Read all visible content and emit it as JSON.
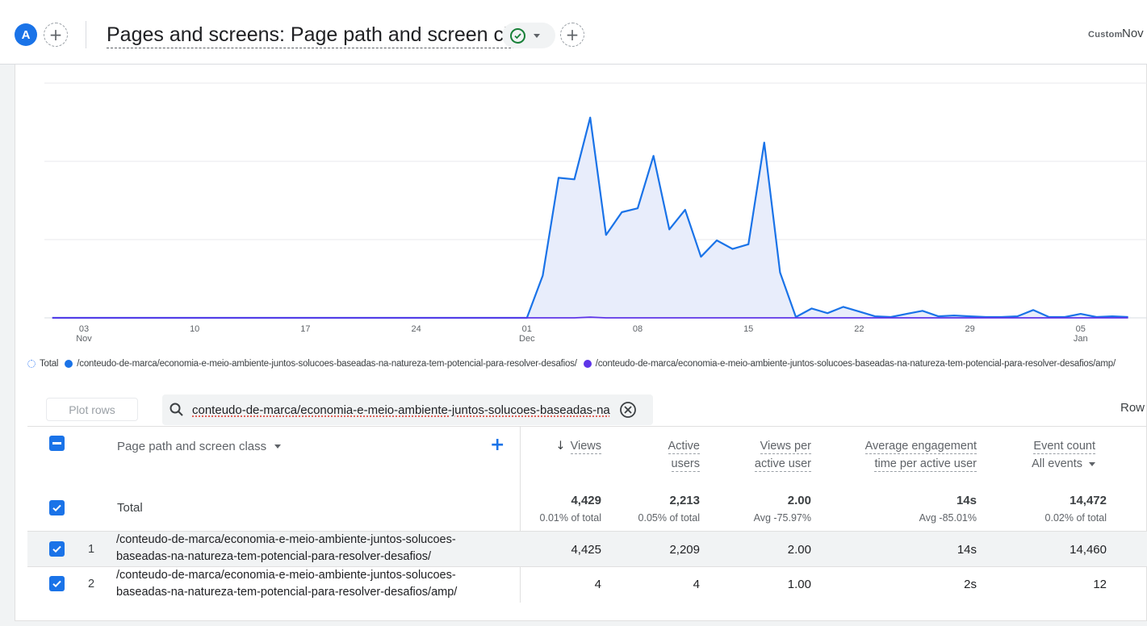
{
  "header": {
    "avatar_letter": "A",
    "title": "Pages and screens: Page path and screen class",
    "custom_label": "Custom",
    "date_label": "Nov"
  },
  "chart_data": {
    "type": "line",
    "x_ticks": [
      {
        "day": "03",
        "month": "Nov"
      },
      {
        "day": "10",
        "month": ""
      },
      {
        "day": "17",
        "month": ""
      },
      {
        "day": "24",
        "month": ""
      },
      {
        "day": "01",
        "month": "Dec"
      },
      {
        "day": "08",
        "month": ""
      },
      {
        "day": "15",
        "month": ""
      },
      {
        "day": "22",
        "month": ""
      },
      {
        "day": "29",
        "month": ""
      },
      {
        "day": "05",
        "month": "Jan"
      }
    ],
    "x_range": [
      "2024-11-01",
      "2025-01-08"
    ],
    "y_range": [
      0,
      1500
    ],
    "grid": true,
    "legend": [
      {
        "name": "Total",
        "color": "#4285f4",
        "style": "dotted"
      },
      {
        "name": "/conteudo-de-marca/economia-e-meio-ambiente-juntos-solucoes-baseadas-na-natureza-tem-potencial-para-resolver-desafios/",
        "color": "#1a73e8",
        "style": "solid"
      },
      {
        "name": "/conteudo-de-marca/economia-e-meio-ambiente-juntos-solucoes-baseadas-na-natureza-tem-potencial-para-resolver-desafios/amp/",
        "color": "#5e35e8",
        "style": "solid"
      }
    ],
    "series": [
      {
        "name": "/conteudo-de-marca/economia-e-meio-ambiente-juntos-solucoes-baseadas-na-natureza-tem-potencial-para-resolver-desafios/",
        "color": "#1a73e8",
        "fill": "#e8edfb",
        "points": [
          [
            "2024-11-01",
            0
          ],
          [
            "2024-11-30",
            0
          ],
          [
            "2024-12-01",
            0
          ],
          [
            "2024-12-02",
            270
          ],
          [
            "2024-12-03",
            895
          ],
          [
            "2024-12-04",
            885
          ],
          [
            "2024-12-05",
            1280
          ],
          [
            "2024-12-06",
            530
          ],
          [
            "2024-12-07",
            675
          ],
          [
            "2024-12-08",
            700
          ],
          [
            "2024-12-09",
            1035
          ],
          [
            "2024-12-10",
            565
          ],
          [
            "2024-12-11",
            690
          ],
          [
            "2024-12-12",
            390
          ],
          [
            "2024-12-13",
            495
          ],
          [
            "2024-12-14",
            440
          ],
          [
            "2024-12-15",
            470
          ],
          [
            "2024-12-16",
            1120
          ],
          [
            "2024-12-17",
            290
          ],
          [
            "2024-12-18",
            5
          ],
          [
            "2024-12-19",
            60
          ],
          [
            "2024-12-20",
            30
          ],
          [
            "2024-12-21",
            70
          ],
          [
            "2024-12-22",
            40
          ],
          [
            "2024-12-23",
            10
          ],
          [
            "2024-12-24",
            5
          ],
          [
            "2024-12-25",
            25
          ],
          [
            "2024-12-26",
            45
          ],
          [
            "2024-12-27",
            10
          ],
          [
            "2024-12-28",
            15
          ],
          [
            "2024-12-29",
            10
          ],
          [
            "2024-12-30",
            5
          ],
          [
            "2024-12-31",
            5
          ],
          [
            "2025-01-01",
            10
          ],
          [
            "2025-01-02",
            50
          ],
          [
            "2025-01-03",
            5
          ],
          [
            "2025-01-04",
            5
          ],
          [
            "2025-01-05",
            25
          ],
          [
            "2025-01-06",
            5
          ],
          [
            "2025-01-07",
            10
          ],
          [
            "2025-01-08",
            5
          ]
        ]
      },
      {
        "name": "/conteudo-de-marca/economia-e-meio-ambiente-juntos-solucoes-baseadas-na-natureza-tem-potencial-para-resolver-desafios/amp/",
        "color": "#5e35e8",
        "points": [
          [
            "2024-11-01",
            0
          ],
          [
            "2024-12-04",
            0
          ],
          [
            "2024-12-05",
            4
          ],
          [
            "2024-12-06",
            0
          ],
          [
            "2025-01-08",
            0
          ]
        ]
      }
    ]
  },
  "table": {
    "plot_rows_label": "Plot rows",
    "search_value": "conteudo-de-marca/economia-e-meio-ambiente-juntos-solucoes-baseadas-na",
    "rows_label": "Row",
    "dimension_header": "Page path and screen class",
    "columns": [
      {
        "line1": "Views",
        "line2": "",
        "sorted": true
      },
      {
        "line1": "Active",
        "line2": "users"
      },
      {
        "line1": "Views per",
        "line2": "active user"
      },
      {
        "line1": "Average engagement",
        "line2": "time per active user"
      },
      {
        "line1": "Event count",
        "line2": "All events"
      }
    ],
    "total": {
      "label": "Total",
      "values": [
        "4,429",
        "2,213",
        "2.00",
        "14s",
        "14,472"
      ],
      "subs": [
        "0.01% of total",
        "0.05% of total",
        "Avg -75.97%",
        "Avg -85.01%",
        "0.02% of total"
      ]
    },
    "rows": [
      {
        "index": "1",
        "path_line1": "/conteudo-de-marca/economia-e-meio-ambiente-juntos-solucoes-",
        "path_line2": "baseadas-na-natureza-tem-potencial-para-resolver-desafios/",
        "values": [
          "4,425",
          "2,209",
          "2.00",
          "14s",
          "14,460"
        ]
      },
      {
        "index": "2",
        "path_line1": "/conteudo-de-marca/economia-e-meio-ambiente-juntos-solucoes-",
        "path_line2": "baseadas-na-natureza-tem-potencial-para-resolver-desafios/amp/",
        "values": [
          "4",
          "4",
          "1.00",
          "2s",
          "12"
        ]
      }
    ]
  }
}
